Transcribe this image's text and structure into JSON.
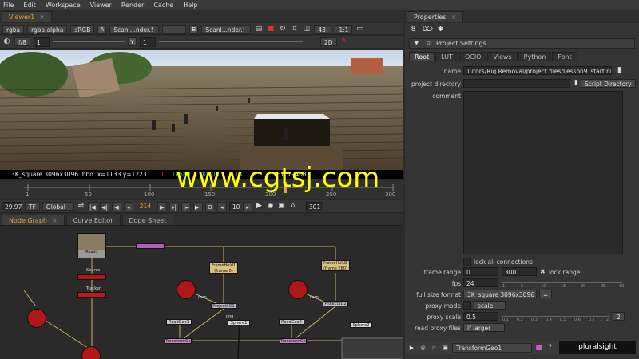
{
  "menu": [
    "File",
    "Edit",
    "Workspace",
    "Viewer",
    "Render",
    "Cache",
    "Help"
  ],
  "viewer": {
    "tab": "Viewer1",
    "toolbar1": {
      "channels": "rgba",
      "alpha": "rgba.alpha",
      "colorspace": "sRGB",
      "a_label": "A",
      "a_input": "Scanl...nder.!",
      "a_op": "-",
      "b_label": "B",
      "b_input": "Scanl...nder.!",
      "gain": "43.",
      "zoom": "1:1"
    },
    "toolbar2": {
      "fstop": "f/8",
      "gain_val": "1",
      "y_label": "Y",
      "gamma_val": "1",
      "view_mode": "2D"
    },
    "info": {
      "format": "3K_square 3096x3096",
      "bbox": "bbo",
      "coords": "x=1133 y=1223",
      "r": "0.",
      "g": "18589",
      "b": "1.00000",
      "hsv": "3.13",
      "l": "L: 0.19408"
    },
    "timeline": {
      "ticks": [
        "1",
        "50",
        "100",
        "150",
        "200",
        "250",
        "300"
      ]
    },
    "transport": {
      "fps": "29.97",
      "tf": "TF",
      "scope": "Global",
      "frame": "214",
      "step": "10",
      "end": "301"
    }
  },
  "node_graph": {
    "tabs": [
      "Node Graph",
      "Curve Editor",
      "Dope Sheet"
    ],
    "nodes": {
      "read1": "Read1",
      "frameHold1": "FrameHold1",
      "frameHold1_sub": "(frame 0)",
      "frameHold2": "FrameHold2",
      "frameHold2_sub": "(frame 280)",
      "project3d1": "Project3D1",
      "project3d2": "Project3D2",
      "readgeo1": "ReadGeo1",
      "readgeo2": "ReadGeo2",
      "sphere1": "Sphere1",
      "sphere2": "Sphere2",
      "transformGeo": "TransformGeo",
      "source": "Source",
      "tracker": "Tracker",
      "cam": "cam",
      "img": "img"
    }
  },
  "properties": {
    "tab": "Properties",
    "panel_title": "Project Settings",
    "subtabs": [
      "Root",
      "LUT",
      "OCIO",
      "Views",
      "Python",
      "Font"
    ],
    "name_label": "name",
    "name_value": "Tutors/Rig Removal/project files/Lesson9_start.nk",
    "project_directory_label": "project directory",
    "script_directory_button": "Script Directory",
    "comment_label": "comment",
    "lock_connections": "lock all connections",
    "frame_range_label": "frame range",
    "frame_start": "0",
    "frame_end": "300",
    "lock_range": "lock range",
    "fps_label": "fps",
    "fps_value": "24",
    "full_size_label": "full size format",
    "full_size_value": "3K_square 3096x3096",
    "proxy_mode_label": "proxy mode",
    "proxy_mode_value": "scale",
    "proxy_scale_label": "proxy scale",
    "proxy_scale_value": "0.5",
    "read_proxy_label": "read proxy files",
    "read_proxy_value": "if larger",
    "fps_ticks": [
      "1",
      "5",
      "10",
      "15",
      "20",
      "25",
      "30"
    ],
    "scale_ticks": [
      "0.1",
      "0.2",
      "0.3",
      "0.4",
      "0.5",
      "0.6",
      "0.7",
      "1",
      "2"
    ],
    "proxy_step": "2",
    "bottom_node": "TransformGeo1"
  },
  "watermark": "www.cgtsj.com",
  "brand": "pluralsight",
  "colors": {
    "accent": "#f0a030",
    "watermark": "#ffff00",
    "node_red": "#b01818"
  }
}
